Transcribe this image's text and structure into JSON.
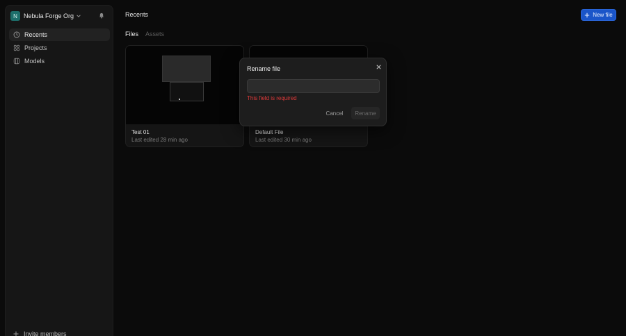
{
  "sidebar": {
    "org": {
      "initial": "N",
      "name": "Nebula Forge Org",
      "chevron_icon": "chevron-down-icon"
    },
    "bell_icon": "bell-icon",
    "items": [
      {
        "label": "Recents",
        "icon": "clock-icon",
        "active": true
      },
      {
        "label": "Projects",
        "icon": "grid-icon",
        "active": false
      },
      {
        "label": "Models",
        "icon": "cube-icon",
        "active": false
      }
    ],
    "invite_label": "Invite members"
  },
  "header": {
    "title": "Recents",
    "new_file_label": "New file"
  },
  "tabs": [
    {
      "label": "Files",
      "active": true
    },
    {
      "label": "Assets",
      "active": false
    }
  ],
  "files": [
    {
      "name": "Test 01",
      "meta": "Last edited 28 min ago"
    },
    {
      "name": "Default File",
      "meta": "Last edited 30 min ago"
    }
  ],
  "modal": {
    "title": "Rename file",
    "input_value": "",
    "error": "This field is required",
    "cancel_label": "Cancel",
    "rename_label": "Rename"
  },
  "colors": {
    "accent": "#1a55c9",
    "error": "#e03a3a",
    "background": "#0b0b0b"
  }
}
